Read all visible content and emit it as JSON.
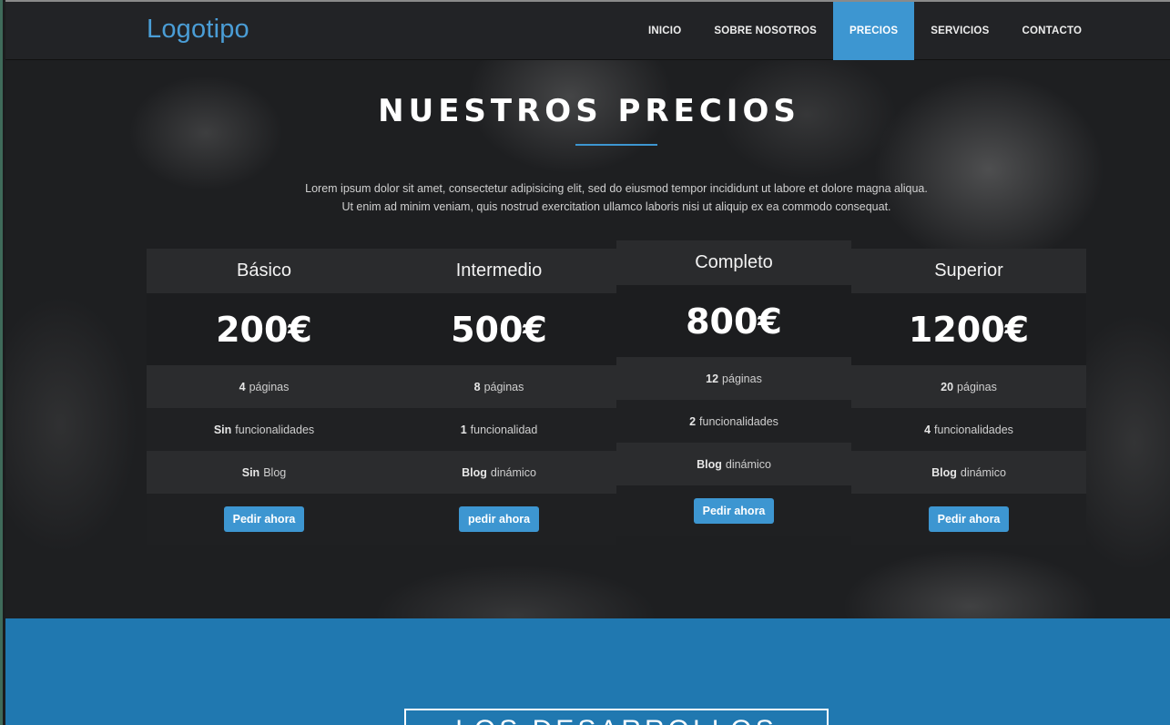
{
  "header": {
    "logo": "Logotipo",
    "nav": [
      {
        "label": "INICIO",
        "active": false
      },
      {
        "label": "SOBRE NOSOTROS",
        "active": false
      },
      {
        "label": "PRECIOS",
        "active": true
      },
      {
        "label": "SERVICIOS",
        "active": false
      },
      {
        "label": "CONTACTO",
        "active": false
      }
    ]
  },
  "hero": {
    "title": "NUESTROS PRECIOS",
    "description_line1": "Lorem ipsum dolor sit amet, consectetur adipisicing elit, sed do eiusmod tempor incididunt ut labore et dolore magna aliqua.",
    "description_line2": "Ut enim ad minim veniam, quis nostrud exercitation ullamco laboris nisi ut aliquip ex ea commodo consequat."
  },
  "plans": [
    {
      "name": "Básico",
      "price": "200€",
      "features": [
        {
          "bold": "4",
          "text": "páginas"
        },
        {
          "bold": "Sin",
          "text": "funcionalidades"
        },
        {
          "bold": "Sin",
          "text": "Blog"
        }
      ],
      "button": "Pedir ahora"
    },
    {
      "name": "Intermedio",
      "price": "500€",
      "features": [
        {
          "bold": "8",
          "text": "páginas"
        },
        {
          "bold": "1",
          "text": "funcionalidad"
        },
        {
          "bold": "Blog",
          "text": "dinámico"
        }
      ],
      "button": "pedir ahora"
    },
    {
      "name": "Completo",
      "price": "800€",
      "features": [
        {
          "bold": "12",
          "text": "páginas"
        },
        {
          "bold": "2",
          "text": "funcionalidades"
        },
        {
          "bold": "Blog",
          "text": "dinámico"
        }
      ],
      "button": "Pedir ahora"
    },
    {
      "name": "Superior",
      "price": "1200€",
      "features": [
        {
          "bold": "20",
          "text": "páginas"
        },
        {
          "bold": "4",
          "text": "funcionalidades"
        },
        {
          "bold": "Blog",
          "text": "dinámico"
        }
      ],
      "button": "Pedir ahora"
    }
  ],
  "section": {
    "title": "LOS DESARROLLOS INCLUYEN"
  },
  "colors": {
    "accent": "#3d96d1",
    "section_blue": "#2078b0"
  }
}
